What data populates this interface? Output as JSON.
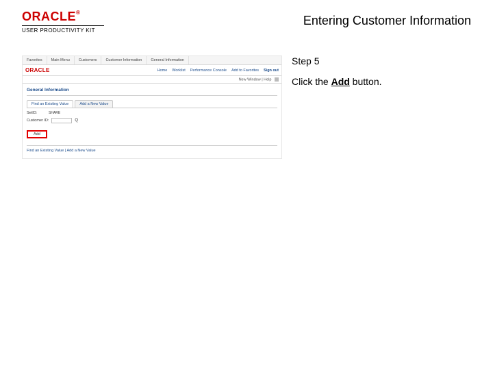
{
  "header": {
    "logo_text": "ORACLE",
    "logo_tm": "®",
    "logo_sub": "USER PRODUCTIVITY KIT",
    "doc_title": "Entering Customer Information"
  },
  "instructions": {
    "step_label": "Step 5",
    "text_prefix": "Click the ",
    "bold_word": "Add",
    "text_suffix": " button."
  },
  "mock": {
    "nav": [
      "Favorites",
      "Main Menu",
      "Customers",
      "Customer Information",
      "General Information"
    ],
    "brand": "ORACLE",
    "toplinks": [
      "Home",
      "Worklist",
      "Performance Console",
      "Add to Favorites",
      "Sign out"
    ],
    "subbar": "New Window | Help",
    "section_title": "General Information",
    "tabs": {
      "active": "Find an Existing Value",
      "inactive": "Add a New Value"
    },
    "form": {
      "setid_label": "SetID:",
      "setid_value": "SHARE",
      "custid_label": "Customer ID:",
      "custid_value": ""
    },
    "add_button_label": "Add",
    "history_link": "Find an Existing Value | Add a New Value"
  }
}
